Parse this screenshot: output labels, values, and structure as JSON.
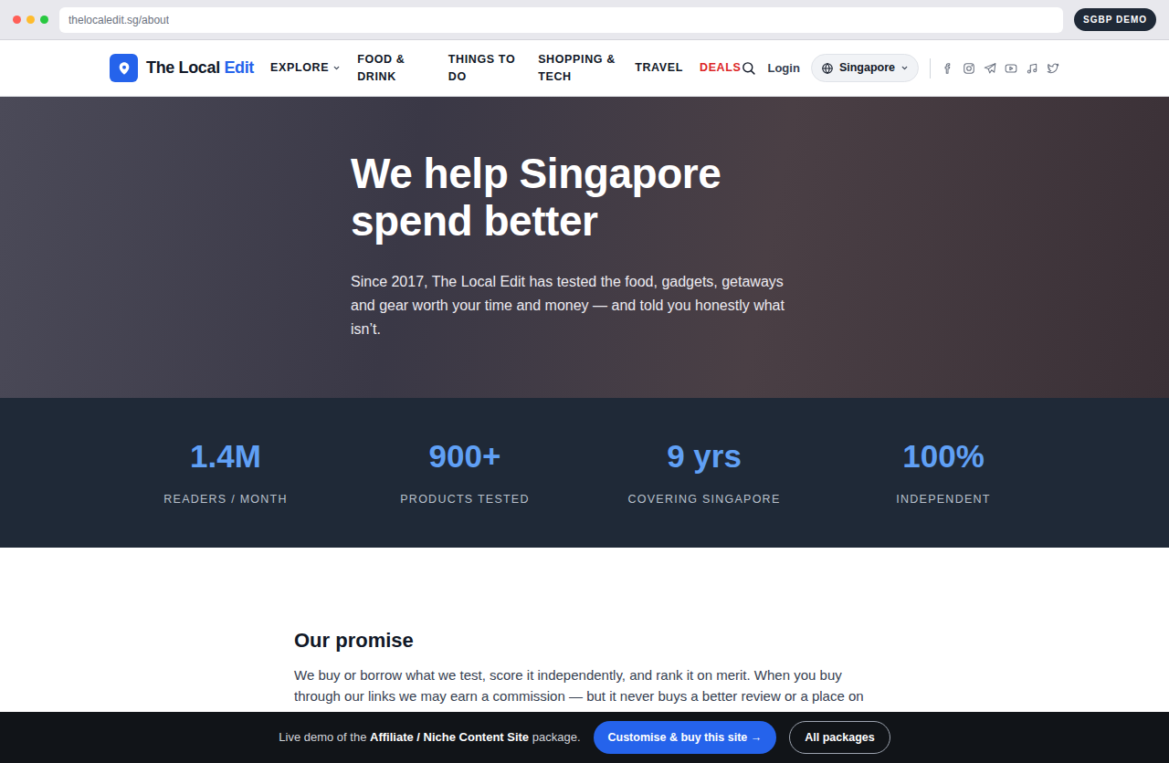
{
  "browser": {
    "url": "thelocaledit.sg/about",
    "badge": "SGBP DEMO"
  },
  "nav": {
    "logo": {
      "first": "The Local",
      "second": "Edit"
    },
    "items": [
      {
        "label": "EXPLORE",
        "dropdown": true,
        "color": "#111827"
      },
      {
        "label": "FOOD & DRINK",
        "dropdown": false,
        "color": "#111827"
      },
      {
        "label": "THINGS TO DO",
        "dropdown": false,
        "color": "#111827"
      },
      {
        "label": "SHOPPING & TECH",
        "dropdown": false,
        "color": "#111827"
      },
      {
        "label": "TRAVEL",
        "dropdown": false,
        "color": "#111827"
      },
      {
        "label": "DEALS",
        "dropdown": false,
        "color": "#dc2626"
      }
    ],
    "login": "Login",
    "region": "Singapore"
  },
  "hero": {
    "title": "We help Singapore spend better",
    "text": "Since 2017, The Local Edit has tested the food, gadgets, getaways and gear worth your time and money — and told you honestly what isn’t."
  },
  "stats": [
    {
      "value": "1.4M",
      "label": "READERS / MONTH"
    },
    {
      "value": "900+",
      "label": "PRODUCTS TESTED"
    },
    {
      "value": "9 yrs",
      "label": "COVERING SINGAPORE"
    },
    {
      "value": "100%",
      "label": "INDEPENDENT"
    }
  ],
  "promise": {
    "title": "Our promise",
    "text": "We buy or borrow what we test, score it independently, and rank it on merit. When you buy through our links we may earn a commission — but it never buys a better review or a place on a"
  },
  "demo_bar": {
    "prefix": "Live demo of the",
    "package": "Affiliate / Niche Content Site",
    "suffix": "package.",
    "primary": "Customise & buy this site →",
    "secondary": "All packages"
  }
}
